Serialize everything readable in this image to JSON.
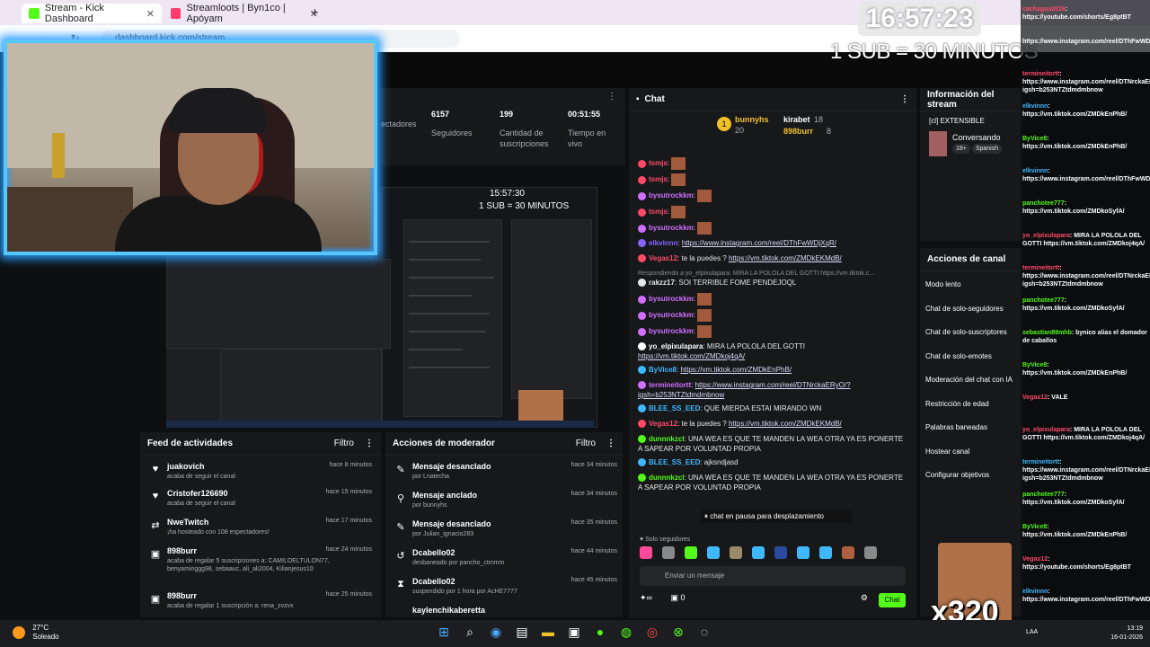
{
  "browser": {
    "tabs": [
      {
        "title": "Stream - Kick Dashboard",
        "icon_color": "#53fc18"
      },
      {
        "title": "Streamloots | Byn1co | Apóyam",
        "icon_color": "#ff3a6e"
      }
    ],
    "url": "dashboard.kick.com/stream"
  },
  "overlay": {
    "clock": "16:57:23",
    "subs_rule": "1 SUB = 30 MINUTOS",
    "meme_label": "x320"
  },
  "stats": {
    "items": [
      {
        "value": "",
        "label": "ectadores"
      },
      {
        "value": "6157",
        "label": "Seguidores"
      },
      {
        "value": "199",
        "label": "Cantidad de suscripciones"
      },
      {
        "value": "00:51:55",
        "label": "Tiempo en vivo"
      }
    ],
    "preview_time": "15:57:30",
    "preview_rule": "1 SUB = 30 MINUTOS"
  },
  "feed": {
    "title": "Feed de actividades",
    "filter": "Filtro",
    "items": [
      {
        "icon": "heart-icon",
        "name": "juakovich",
        "sub": "acaba de seguir el canal",
        "time": "hace 8 minutos"
      },
      {
        "icon": "heart-icon",
        "name": "Cristofer126690",
        "sub": "acaba de seguir el canal",
        "time": "hace 15 minutos"
      },
      {
        "icon": "host-icon",
        "name": "NweTwitch",
        "sub": "¡ha hosteado con 108 espectadores!",
        "time": "hace 17 minutos"
      },
      {
        "icon": "gift-icon",
        "name": "898burr",
        "sub": "acaba de regalar 5 suscripciones a: CAMILOELTULON77, benyaminggg98, sebaauc, ali_ali2004, Kilianjesus10",
        "time": "hace 24 minutos"
      },
      {
        "icon": "gift-icon",
        "name": "898burr",
        "sub": "acaba de regalar 1 suscripción a: rena_zvzvx",
        "time": "hace 25 minutos"
      }
    ]
  },
  "modactions": {
    "title": "Acciones de moderador",
    "filter": "Filtro",
    "items": [
      {
        "icon": "unpin-icon",
        "name": "Mensaje desanclado",
        "sub": "por Lnatecha",
        "time": "hace 34 minutos"
      },
      {
        "icon": "pin-icon",
        "name": "Mensaje anclado",
        "sub": "por bunnyhs",
        "time": "hace 34 minutos"
      },
      {
        "icon": "unpin-icon",
        "name": "Mensaje desanclado",
        "sub": "por Julian_ignacio283",
        "time": "hace 35 minutos"
      },
      {
        "icon": "unban-icon",
        "name": "Dcabello02",
        "sub": "desbaneado por pancho_ctmmm",
        "time": "hace 44 minutos"
      },
      {
        "icon": "timeout-icon",
        "name": "Dcabello02",
        "sub": "suspendido por 1 hora por AcHE7777",
        "time": "hace 45 minutos"
      },
      {
        "icon": "",
        "name": "kaylenchikaberetta",
        "sub": "",
        "time": ""
      }
    ]
  },
  "chat": {
    "title": "Chat",
    "pinned": [
      {
        "name": "bunnyhs",
        "count": "20"
      },
      {
        "name": "kirabet",
        "count": "18"
      },
      {
        "name": "898burr",
        "count": "8"
      }
    ],
    "messages": [
      {
        "user": "tsmjs",
        "color": "#ff4a6a",
        "text": ":",
        "emote": true
      },
      {
        "user": "tsmjs",
        "color": "#ff4a6a",
        "text": ":",
        "emote": true
      },
      {
        "user": "bysutrockkm",
        "color": "#d070ff",
        "text": ":",
        "emote": true
      },
      {
        "user": "tsmjs",
        "color": "#ff4a6a",
        "text": ":",
        "emote": true
      },
      {
        "user": "bysutrockkm",
        "color": "#d070ff",
        "text": ":",
        "emote": true
      },
      {
        "user": "elkvinnn",
        "color": "#8a63ff",
        "text": ": ",
        "link": "https://www.instagram.com/reel/DThFwWDjXqR/"
      },
      {
        "user": "Vegas12",
        "color": "#ff4a6a",
        "text": ": te la puedes ? ",
        "link": "https://vm.tiktok.com/ZMDkEKMdB/"
      },
      {
        "user": "rakzz17",
        "color": "#e6e6e6",
        "text": ": SOI TERRIBLE FOME PENDEJOQL",
        "reply": "Respondiendo a yo_elpixulapara: MIRA LA POLOLA DEL GOTTI https://vm.tiktok.c..."
      },
      {
        "user": "bysutrockkm",
        "color": "#d070ff",
        "text": ":",
        "emote": true
      },
      {
        "user": "bysutrockkm",
        "color": "#d070ff",
        "text": ":",
        "emote": true
      },
      {
        "user": "bysutrockkm",
        "color": "#d070ff",
        "text": ":",
        "emote": true
      },
      {
        "user": "yo_elpixulapara",
        "color": "#ffffff",
        "text": ": MIRA LA POLOLA DEL GOTTI ",
        "link": "https://vm.tiktok.com/ZMDkoj4qA/"
      },
      {
        "user": "ByVice8",
        "color": "#40b8ff",
        "text": ": ",
        "link": "https://vm.tiktok.com/ZMDkEnPhB/"
      },
      {
        "user": "termineitortt",
        "color": "#d070ff",
        "text": ": ",
        "link": "https://www.instagram.com/reel/DTNrckaERyO/?igsh=b253NTZtdmdmbnow"
      },
      {
        "user": "BLEE_SS_EED",
        "color": "#40b8ff",
        "text": ": QUE MIERDA ESTAI MIRANDO WN"
      },
      {
        "user": "Vegas12",
        "color": "#ff4a6a",
        "text": ": te la puedes ? ",
        "link": "https://vm.tiktok.com/ZMDkEKMdB/"
      },
      {
        "user": "dunnnkzcl",
        "color": "#53fc18",
        "text": ": UNA WEA ES QUE TE MANDEN LA WEA OTRA YA ES PONERTE A SAPEAR POR VOLUNTAD PROPIA"
      },
      {
        "user": "BLEE_SS_EED",
        "color": "#40b8ff",
        "text": ": ajksndjasd"
      },
      {
        "user": "dunnnkzcl",
        "color": "#53fc18",
        "text": ": UNA WEA ES QUE TE MANDEN LA WEA OTRA YA ES PONERTE A SAPEAR POR VOLUNTAD PROPIA"
      }
    ],
    "paused": "chat en pausa para desplazamiento",
    "solo": "Solo seguidores",
    "input_placeholder": "Enviar un mensaje",
    "viewer_count": "0",
    "send": "Chat"
  },
  "info": {
    "title": "Información del stream",
    "stream_title": "[cl] EXTENSIBLE",
    "category": "Conversando",
    "tags": [
      "18+",
      "Spanish"
    ]
  },
  "actions": {
    "title": "Acciones de canal",
    "items": [
      "Modo lento",
      "Chat de solo-seguidores",
      "Chat de solo-suscriptores",
      "Chat de solo-emotes",
      "Moderación del chat con IA",
      "Restricción de edad",
      "Palabras baneadas",
      "Hostear canal",
      "Configurar objetivos"
    ]
  },
  "sidechat": [
    {
      "u": "cachagua2026",
      "m": ": https://youtube.com/shorts/Eg8ptBT",
      "c": "r"
    },
    {
      "u": "",
      "m": "https://www.instagram.com/reel/DThFwWDjXqR/",
      "c": "n"
    },
    {
      "u": "termineitortt",
      "m": ": https://www.instagram.com/reel/DTNrckaERyO/?igsh=b253NTZtdmdmbnow",
      "c": "r"
    },
    {
      "u": "elkvinnn",
      "m": ": https://vm.tiktok.com/ZMDkEnPhB/",
      "c": "c"
    },
    {
      "u": "ByVice8",
      "m": ": https://vm.tiktok.com/ZMDkEnPhB/",
      "c": "n"
    },
    {
      "u": "elkvinnn",
      "m": ": https://www.instagram.com/reel/DThFwWDjXqR/",
      "c": "c"
    },
    {
      "u": "panchotee777",
      "m": ": https://vm.tiktok.com/ZMDkoSyfA/",
      "c": "n"
    },
    {
      "u": "yo_elpixulapara",
      "m": ": MIRA LA POLOLA DEL GOTTI https://vm.tiktok.com/ZMDkoj4qA/",
      "c": "r"
    },
    {
      "u": "termineitortt",
      "m": ": https://www.instagram.com/reel/DTNrckaERyO/?igsh=b253NTZtdmdmbnow",
      "c": "r"
    },
    {
      "u": "panchotee777",
      "m": ": https://vm.tiktok.com/ZMDkoSyfA/",
      "c": "n"
    },
    {
      "u": "sebastian89mhb",
      "m": ": bynico alias el domador de caballos",
      "c": "n"
    },
    {
      "u": "ByVice8",
      "m": ": https://vm.tiktok.com/ZMDkEnPhB/",
      "c": "n"
    },
    {
      "u": "Vegas12",
      "m": ": VALE",
      "c": "r"
    },
    {
      "u": "yo_elpixulapara",
      "m": ": MIRA LA POLOLA DEL GOTTI https://vm.tiktok.com/ZMDkoj4qA/",
      "c": "r"
    },
    {
      "u": "termineitortt",
      "m": ": https://www.instagram.com/reel/DTNrckaERyO/?igsh=b253NTZtdmdmbnow",
      "c": "c"
    },
    {
      "u": "panchotee777",
      "m": ": https://vm.tiktok.com/ZMDkoSyfA/",
      "c": "n"
    },
    {
      "u": "ByVice8",
      "m": ": https://vm.tiktok.com/ZMDkEnPhB/",
      "c": "n"
    },
    {
      "u": "Vegas12",
      "m": ": https://youtube.com/shorts/Eg8ptBT",
      "c": "r"
    },
    {
      "u": "elkvinnn",
      "m": ": https://www.instagram.com/reel/DThFwWDjXqR/",
      "c": "c"
    }
  ],
  "taskbar": {
    "temp": "27°C",
    "weather": "Soleado",
    "lang": "LAA",
    "time": "13:19",
    "date": "16-01-2026"
  },
  "colors": {
    "kick_green": "#53fc18",
    "cam_glow": "#2a9cff"
  }
}
